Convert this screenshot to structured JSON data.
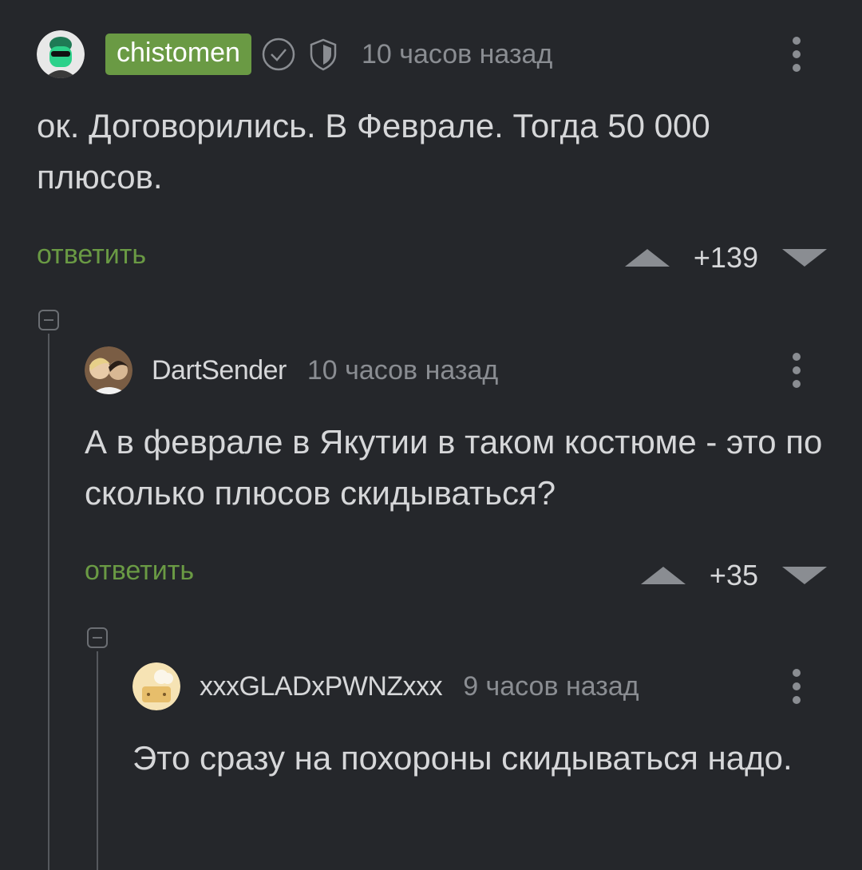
{
  "comments": [
    {
      "username": "chistomen",
      "timestamp": "10 часов назад",
      "text": "ок. Договорились. В Феврале. Тогда 50 000 плюсов.",
      "reply_label": "ответить",
      "score": "+139",
      "badge_color": "#6a9a44",
      "icons": [
        "verified-check-icon",
        "shield-icon"
      ]
    },
    {
      "username": "DartSender",
      "timestamp": "10 часов назад",
      "text": "А в феврале в Якутии в таком костюме - это по сколько плюсов скидываться?",
      "reply_label": "ответить",
      "score": "+35"
    },
    {
      "username": "xxxGLADxPWNZxxx",
      "timestamp": "9 часов назад",
      "text": "Это сразу на похороны скидываться надо."
    }
  ],
  "colors": {
    "background": "#25272b",
    "accent_green": "#6a9a44",
    "muted": "#8a8d92"
  }
}
